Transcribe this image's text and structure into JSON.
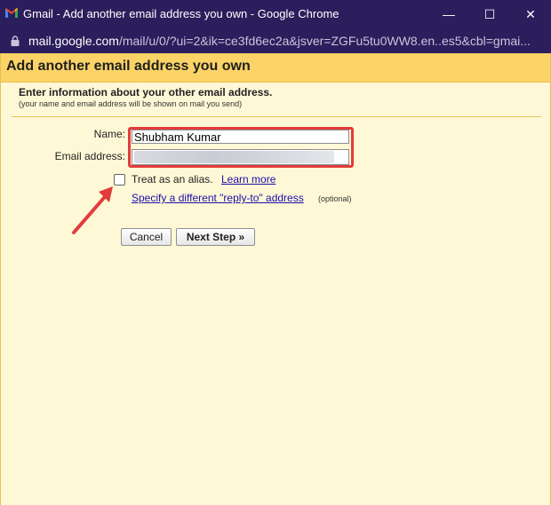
{
  "window": {
    "title": "Gmail - Add another email address you own - Google Chrome",
    "minimize": "—",
    "maximize": "☐",
    "close": "✕"
  },
  "addressbar": {
    "host": "mail.google.com",
    "path": "/mail/u/0/?ui=2&ik=ce3fd6ec2a&jsver=ZGFu5tu0WW8.en..es5&cbl=gmai..."
  },
  "dialog": {
    "title": "Add another email address you own",
    "intro": "Enter information about your other email address.",
    "intro_sub": "(your name and email address will be shown on mail you send)",
    "name_label": "Name:",
    "name_value": "Shubham Kumar",
    "email_label": "Email address:",
    "email_value": "",
    "alias_label": "Treat as an alias.",
    "learn_more": "Learn more",
    "reply_to_link": "Specify a different \"reply-to\" address",
    "optional": "(optional)",
    "cancel_button": "Cancel",
    "next_button": "Next Step »"
  },
  "colors": {
    "titlebar": "#2b1e5c",
    "header": "#fbd366",
    "content_bg": "#fff8d6",
    "highlight": "#e23b3b",
    "link": "#1a0dab"
  }
}
